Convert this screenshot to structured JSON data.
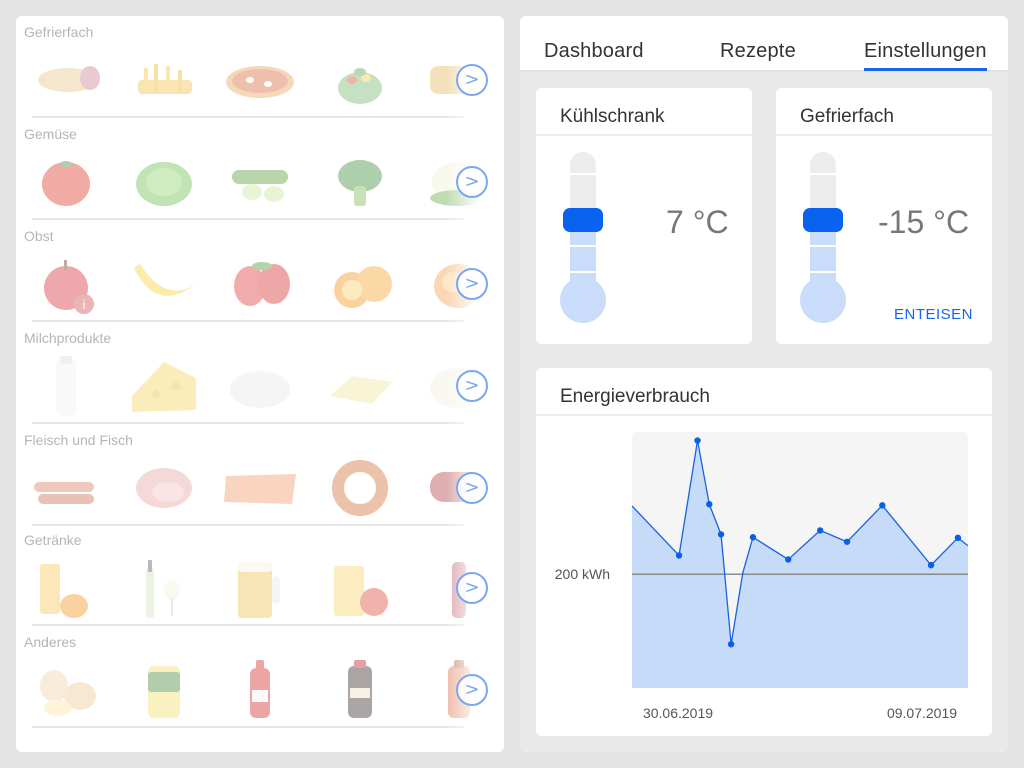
{
  "categories": [
    {
      "title": "Gefrierfach",
      "items": [
        "wrap-icon",
        "fries-icon",
        "pizza-icon",
        "salad-icon",
        "spring-roll-icon"
      ]
    },
    {
      "title": "Gemüse",
      "items": [
        "tomato-icon",
        "lettuce-icon",
        "cucumber-icon",
        "broccoli-icon",
        "cauliflower-icon"
      ]
    },
    {
      "title": "Obst",
      "items": [
        "apple-icon",
        "banana-icon",
        "strawberry-icon",
        "orange-icon",
        "peach-icon"
      ]
    },
    {
      "title": "Milchprodukte",
      "items": [
        "milk-icon",
        "cheese-icon",
        "yogurt-icon",
        "butter-icon",
        "mozzarella-icon"
      ]
    },
    {
      "title": "Fleisch und Fisch",
      "items": [
        "sausages-icon",
        "ham-icon",
        "salmon-icon",
        "ring-sausage-icon",
        "salami-icon"
      ]
    },
    {
      "title": "Getränke",
      "items": [
        "orange-juice-icon",
        "wine-icon",
        "beer-icon",
        "apple-juice-icon",
        "smoothie-icon"
      ]
    },
    {
      "title": "Anderes",
      "items": [
        "eggs-icon",
        "mustard-icon",
        "ketchup-icon",
        "soy-sauce-icon",
        "syrup-icon"
      ]
    }
  ],
  "next_label": ">",
  "tabs": [
    {
      "label": "Dashboard",
      "active": false
    },
    {
      "label": "Rezepte",
      "active": false
    },
    {
      "label": "Einstellungen",
      "active": true
    }
  ],
  "fridge": {
    "title": "Kühlschrank",
    "temperature": "7 °C"
  },
  "freezer": {
    "title": "Gefrierfach",
    "temperature": "-15 °C",
    "defrost_label": "ENTEISEN"
  },
  "energy": {
    "title": "Energieverbrauch"
  },
  "colors": {
    "accent": "#1565e6",
    "thermo_fill": "#c9dcfa",
    "chart_fill": "#c6dbf8",
    "chart_line": "#1a62e0"
  },
  "chart_data": {
    "type": "area",
    "title": "Energieverbrauch",
    "ylabel": "",
    "reference_line": {
      "value": 200,
      "label": "200 kWh"
    },
    "x_tick_labels": [
      "30.06.2019",
      "09.07.2019"
    ],
    "ylim": [
      0,
      450
    ],
    "points": [
      {
        "x": 0,
        "y": 320,
        "marker": false
      },
      {
        "x": 0.14,
        "y": 233,
        "marker": true
      },
      {
        "x": 0.195,
        "y": 435,
        "marker": true
      },
      {
        "x": 0.23,
        "y": 323,
        "marker": true
      },
      {
        "x": 0.265,
        "y": 270,
        "marker": true
      },
      {
        "x": 0.295,
        "y": 77,
        "marker": true
      },
      {
        "x": 0.33,
        "y": 203,
        "marker": false
      },
      {
        "x": 0.36,
        "y": 265,
        "marker": true
      },
      {
        "x": 0.465,
        "y": 226,
        "marker": true
      },
      {
        "x": 0.56,
        "y": 277,
        "marker": true
      },
      {
        "x": 0.64,
        "y": 257,
        "marker": true
      },
      {
        "x": 0.745,
        "y": 321,
        "marker": true
      },
      {
        "x": 0.89,
        "y": 216,
        "marker": true
      },
      {
        "x": 0.97,
        "y": 264,
        "marker": true
      },
      {
        "x": 1.0,
        "y": 250,
        "marker": false
      }
    ]
  }
}
